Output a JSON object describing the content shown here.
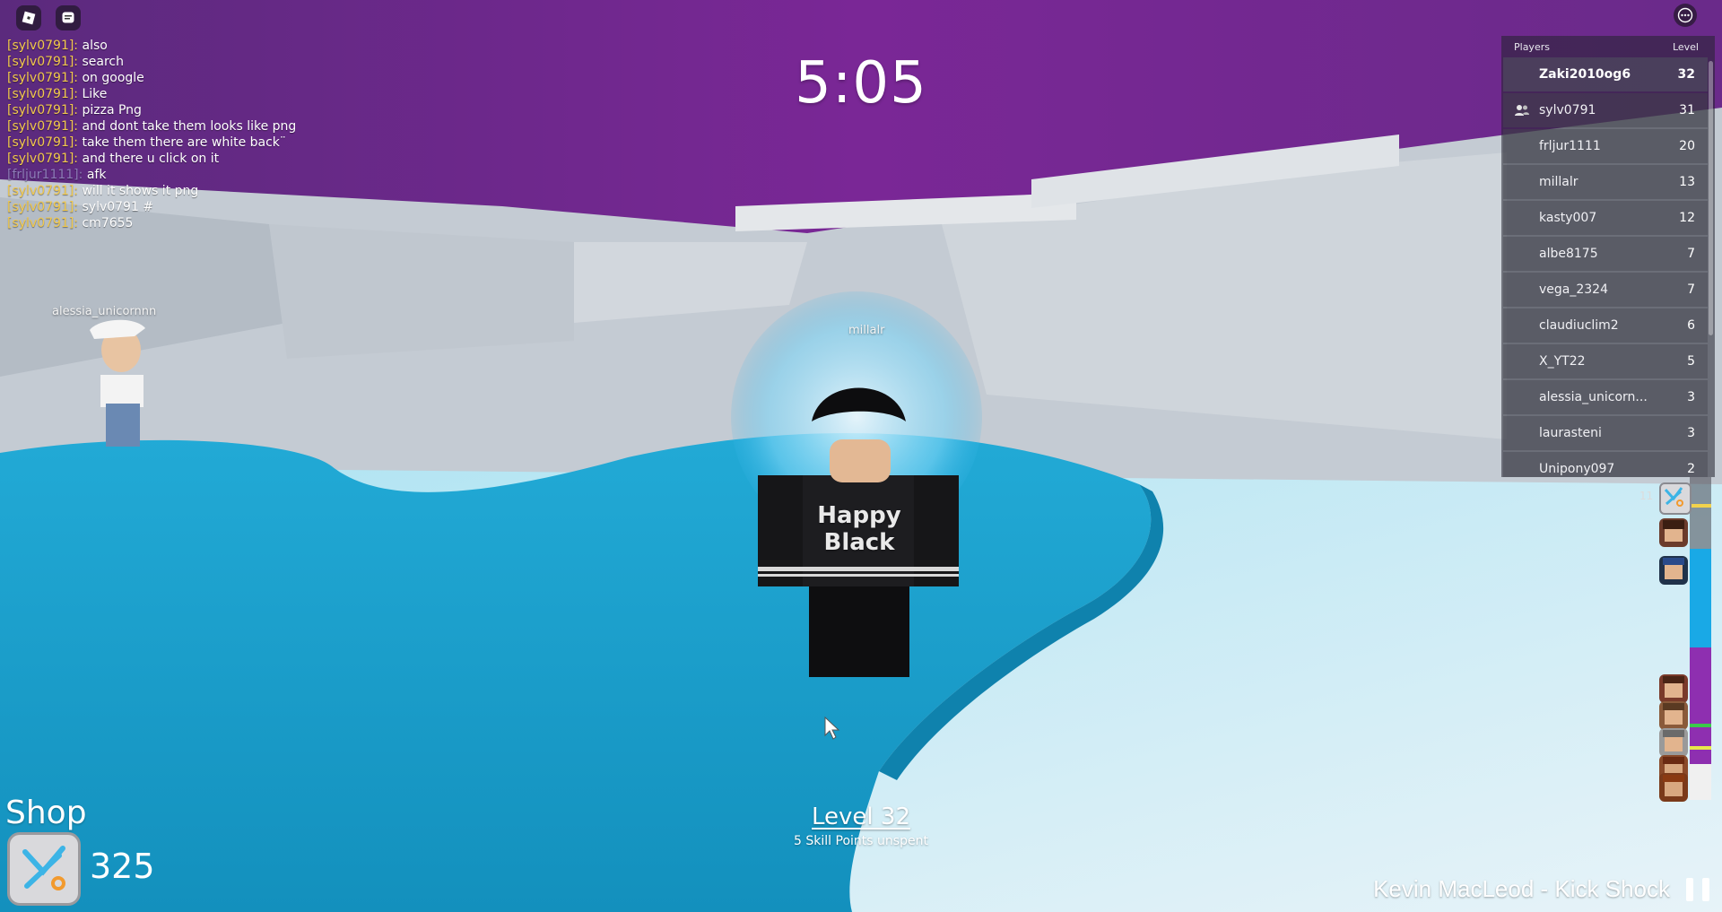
{
  "top_bar": {
    "menu_icon": "roblox-logo-icon",
    "chat_icon": "chat-icon",
    "more_icon": "more-options-icon"
  },
  "chat": {
    "messages": [
      {
        "user": "[sylv0791]:",
        "text": "also"
      },
      {
        "user": "[sylv0791]:",
        "text": "search"
      },
      {
        "user": "[sylv0791]:",
        "text": "on google"
      },
      {
        "user": "[sylv0791]:",
        "text": "Like"
      },
      {
        "user": "[sylv0791]:",
        "text": "pizza Png"
      },
      {
        "user": "[sylv0791]:",
        "text": "and dont take them looks like png"
      },
      {
        "user": "[sylv0791]:",
        "text": "take them there are white back¨"
      },
      {
        "user": "[sylv0791]:",
        "text": "and there u click on it"
      },
      {
        "user": "[frljur1111]:",
        "text": "afk"
      },
      {
        "user": "[sylv0791]:",
        "text": "will it shows it png"
      },
      {
        "user": "[sylv0791]:",
        "text": "sylv0791 #"
      },
      {
        "user": "[sylv0791]:",
        "text": "cm7655"
      }
    ]
  },
  "timer": "5:05",
  "players": {
    "header_players": "Players",
    "header_level": "Level",
    "rows": [
      {
        "name": "Zaki2010og6",
        "level": "32"
      },
      {
        "name": "sylv0791",
        "level": "31"
      },
      {
        "name": "frljur1111",
        "level": "20"
      },
      {
        "name": "millalr",
        "level": "13"
      },
      {
        "name": "kasty007",
        "level": "12"
      },
      {
        "name": "albe8175",
        "level": "7"
      },
      {
        "name": "vega_2324",
        "level": "7"
      },
      {
        "name": "claudiuclim2",
        "level": "6"
      },
      {
        "name": "X_YT22",
        "level": "5"
      },
      {
        "name": "alessia_unicorn...",
        "level": "3"
      },
      {
        "name": "laurasteni",
        "level": "3"
      },
      {
        "name": "Unipony097",
        "level": "2"
      }
    ]
  },
  "side_badge": "11",
  "world": {
    "nametag_left": "alessia_unicornnn",
    "nametag_center": "millalr",
    "shirt_line1": "Happy",
    "shirt_line2": "Black"
  },
  "shop": {
    "label": "Shop",
    "count": "325",
    "icon": "shop-logo-icon"
  },
  "level": {
    "title": "Level 32",
    "subtitle": "5 Skill Points unspent"
  },
  "music": {
    "now_playing": "Kevin MacLeod - Kick Shock",
    "pause_icon": "pause-icon"
  },
  "colors": {
    "sky_purple": "#6f2590",
    "water": "#1aa0c9",
    "ice": "#c9d3db",
    "chat_user": "#f2c94c"
  }
}
